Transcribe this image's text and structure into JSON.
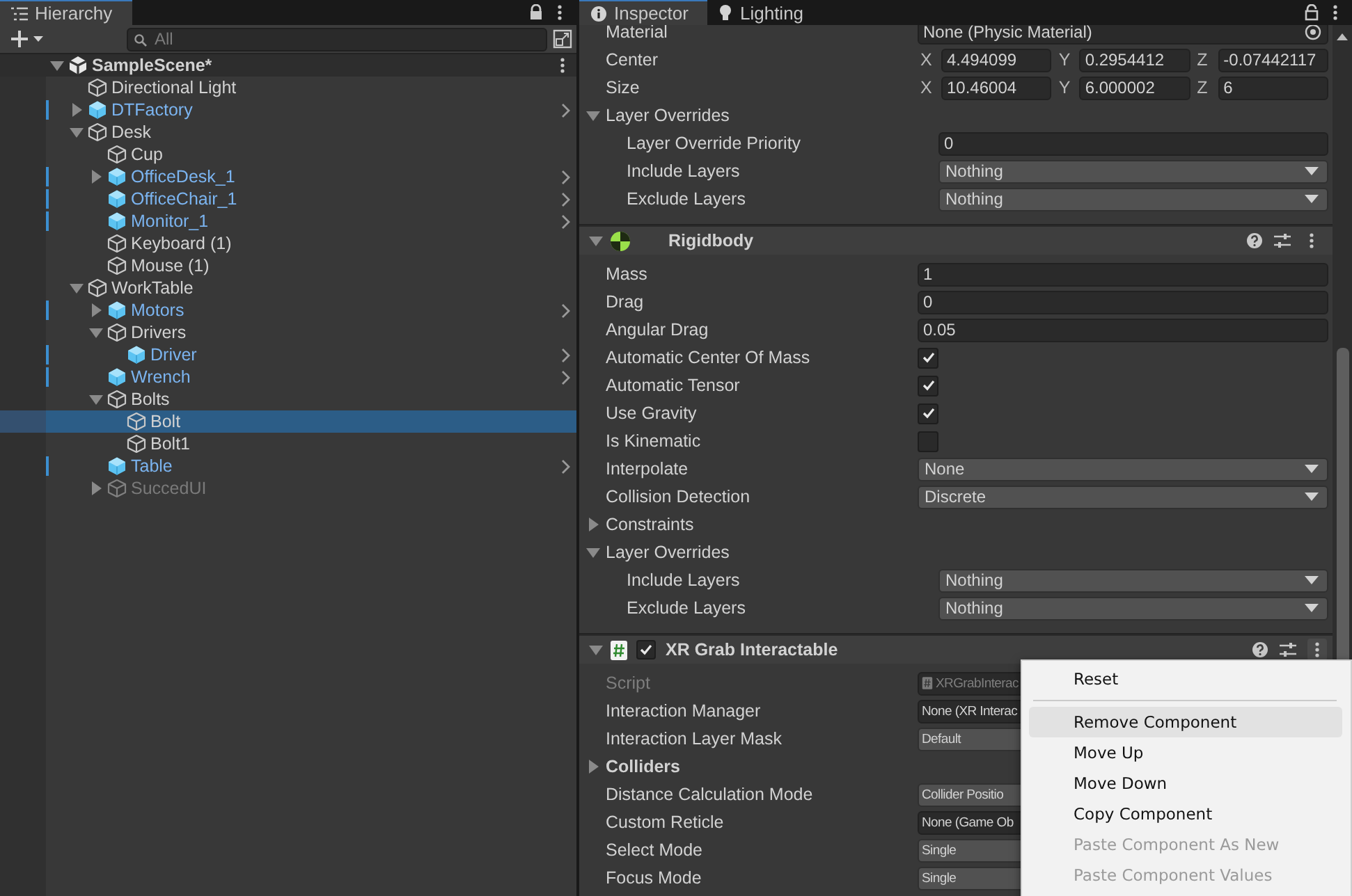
{
  "hierarchy": {
    "tab": "Hierarchy",
    "search": {
      "placeholder": "All"
    },
    "scene": {
      "name": "SampleScene*",
      "expanded": true,
      "children": [
        {
          "name": "Directional Light",
          "prefab": false,
          "active": true,
          "selected": false
        },
        {
          "name": "DTFactory",
          "prefab": true,
          "active": true,
          "selected": false,
          "expanded": false
        },
        {
          "name": "Desk",
          "prefab": false,
          "active": true,
          "selected": false,
          "expanded": true,
          "children": [
            {
              "name": "Cup",
              "prefab": false,
              "active": true,
              "selected": false
            },
            {
              "name": "OfficeDesk_1",
              "prefab": true,
              "active": true,
              "selected": false,
              "expanded": false
            },
            {
              "name": "OfficeChair_1",
              "prefab": true,
              "active": true,
              "selected": false
            },
            {
              "name": "Monitor_1",
              "prefab": true,
              "active": true,
              "selected": false
            },
            {
              "name": "Keyboard (1)",
              "prefab": false,
              "active": true,
              "selected": false
            },
            {
              "name": "Mouse (1)",
              "prefab": false,
              "active": true,
              "selected": false
            }
          ]
        },
        {
          "name": "WorkTable",
          "prefab": false,
          "active": true,
          "selected": false,
          "expanded": true,
          "children": [
            {
              "name": "Motors",
              "prefab": true,
              "active": true,
              "selected": false,
              "expanded": false
            },
            {
              "name": "Drivers",
              "prefab": false,
              "active": true,
              "selected": false,
              "expanded": true,
              "children": [
                {
                  "name": "Driver",
                  "prefab": true,
                  "active": true,
                  "selected": false
                }
              ]
            },
            {
              "name": "Wrench",
              "prefab": true,
              "active": true,
              "selected": false
            },
            {
              "name": "Bolts",
              "prefab": false,
              "active": true,
              "selected": false,
              "expanded": true,
              "children": [
                {
                  "name": "Bolt",
                  "prefab": false,
                  "active": true,
                  "selected": true
                },
                {
                  "name": "Bolt1",
                  "prefab": false,
                  "active": true,
                  "selected": false
                }
              ]
            },
            {
              "name": "Table",
              "prefab": true,
              "active": true,
              "selected": false
            },
            {
              "name": "SuccedUI",
              "prefab": false,
              "active": false,
              "selected": false,
              "expanded": false
            }
          ]
        }
      ]
    }
  },
  "inspector": {
    "tabs": [
      {
        "label": "Inspector",
        "selected": true
      },
      {
        "label": "Lighting",
        "selected": false
      }
    ],
    "components": [
      {
        "rows": [
          {
            "kind": "object",
            "label": "Material",
            "value": "None (Physic Material)",
            "picker": true
          },
          {
            "kind": "vector3",
            "label": "Center",
            "fields": [
              {
                "axis": "X",
                "value": "4.494099"
              },
              {
                "axis": "Y",
                "value": "0.2954412"
              },
              {
                "axis": "Z",
                "value": "-0.07442117"
              }
            ]
          },
          {
            "kind": "vector3",
            "label": "Size",
            "fields": [
              {
                "axis": "X",
                "value": "10.46004"
              },
              {
                "axis": "Y",
                "value": "6.000002"
              },
              {
                "axis": "Z",
                "value": "6"
              }
            ]
          },
          {
            "kind": "foldout",
            "label": "Layer Overrides",
            "expanded": true,
            "children": [
              {
                "kind": "number",
                "label": "Layer Override Priority",
                "value": "0"
              },
              {
                "kind": "dropdown",
                "label": "Include Layers",
                "value": "Nothing"
              },
              {
                "kind": "dropdown",
                "label": "Exclude Layers",
                "value": "Nothing"
              }
            ]
          }
        ]
      },
      {
        "title": "Rigidbody",
        "kind": "rigidbody",
        "rows": [
          {
            "kind": "number",
            "label": "Mass",
            "value": "1"
          },
          {
            "kind": "number",
            "label": "Drag",
            "value": "0"
          },
          {
            "kind": "number",
            "label": "Angular Drag",
            "value": "0.05"
          },
          {
            "kind": "checkbox",
            "label": "Automatic Center Of Mass",
            "checked": true
          },
          {
            "kind": "checkbox",
            "label": "Automatic Tensor",
            "checked": true
          },
          {
            "kind": "checkbox",
            "label": "Use Gravity",
            "checked": true
          },
          {
            "kind": "checkbox",
            "label": "Is Kinematic",
            "checked": false
          },
          {
            "kind": "dropdown",
            "label": "Interpolate",
            "value": "None"
          },
          {
            "kind": "dropdown",
            "label": "Collision Detection",
            "value": "Discrete"
          },
          {
            "kind": "foldout",
            "label": "Constraints",
            "expanded": false
          },
          {
            "kind": "foldout",
            "label": "Layer Overrides",
            "expanded": true,
            "children": [
              {
                "kind": "dropdown",
                "label": "Include Layers",
                "value": "Nothing"
              },
              {
                "kind": "dropdown",
                "label": "Exclude Layers",
                "value": "Nothing"
              }
            ]
          }
        ]
      },
      {
        "title": "XR Grab Interactable",
        "kind": "script",
        "enabled": true,
        "rows": [
          {
            "kind": "script",
            "label": "Script",
            "value": "XRGrabInterac"
          },
          {
            "kind": "object",
            "label": "Interaction Manager",
            "value": "None (XR Interac"
          },
          {
            "kind": "dropdown",
            "label": "Interaction Layer Mask",
            "value": "Default"
          },
          {
            "kind": "group",
            "label": "Colliders",
            "expanded": false
          },
          {
            "kind": "dropdown",
            "label": "Distance Calculation Mode",
            "value": "Collider Positio"
          },
          {
            "kind": "object",
            "label": "Custom Reticle",
            "value": "None (Game Ob"
          },
          {
            "kind": "dropdown",
            "label": "Select Mode",
            "value": "Single"
          },
          {
            "kind": "dropdown",
            "label": "Focus Mode",
            "value": "Single"
          }
        ],
        "menu": {
          "groups": [
            [
              {
                "label": "Reset",
                "disabled": false,
                "selected": false
              }
            ],
            [
              {
                "label": "Remove Component",
                "disabled": false,
                "selected": true
              },
              {
                "label": "Move Up",
                "disabled": false,
                "selected": false
              },
              {
                "label": "Move Down",
                "disabled": false,
                "selected": false
              },
              {
                "label": "Copy Component",
                "disabled": false,
                "selected": false
              },
              {
                "label": "Paste Component As New",
                "disabled": true,
                "selected": false
              },
              {
                "label": "Paste Component Values",
                "disabled": true,
                "selected": false
              }
            ]
          ]
        }
      }
    ]
  }
}
